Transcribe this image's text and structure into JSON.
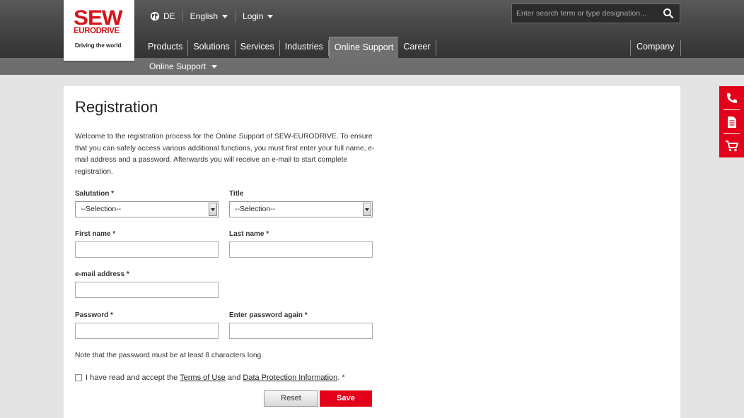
{
  "brand": {
    "logo_main": "SEW",
    "logo_sub": "EURODRIVE",
    "tagline": "Driving the world"
  },
  "topbar": {
    "country": "DE",
    "language": "English",
    "login": "Login"
  },
  "search": {
    "placeholder": "Enter search term or type designation..."
  },
  "nav": {
    "items": [
      "Products",
      "Solutions",
      "Services",
      "Industries",
      "Online Support",
      "Career"
    ],
    "active": "Online Support",
    "company": "Company"
  },
  "subnav": {
    "label": "Online Support"
  },
  "form": {
    "title": "Registration",
    "intro": "Welcome to the registration process for the Online Support of SEW-EURODRIVE. To ensure that you can safely access various additional functions, you must first enter your full name, e-mail address and a password. Afterwards you will receive an e-mail to start complete registration.",
    "salutation_label": "Salutation  *",
    "salutation_value": "--Selection--",
    "title_label": "Title",
    "title_value": "--Selection--",
    "first_name_label": "First name  *",
    "last_name_label": "Last name  *",
    "email_label": "e-mail address  *",
    "password_label": "Password  *",
    "password_again_label": "Enter password again  *",
    "password_note": "Note that the password must be at least 8 characters long.",
    "terms_pre": "I have read and accept the ",
    "terms_link": "Terms of Use",
    "terms_mid": " and ",
    "privacy_link": "Data Protection Information",
    "terms_post": ".  *",
    "reset_label": "Reset",
    "save_label": "Save"
  },
  "side": {
    "icons": [
      "phone-icon",
      "document-icon",
      "cart-icon"
    ]
  },
  "colors": {
    "brand_red": "#e2001a",
    "header_dark": "#3c3c3c"
  }
}
